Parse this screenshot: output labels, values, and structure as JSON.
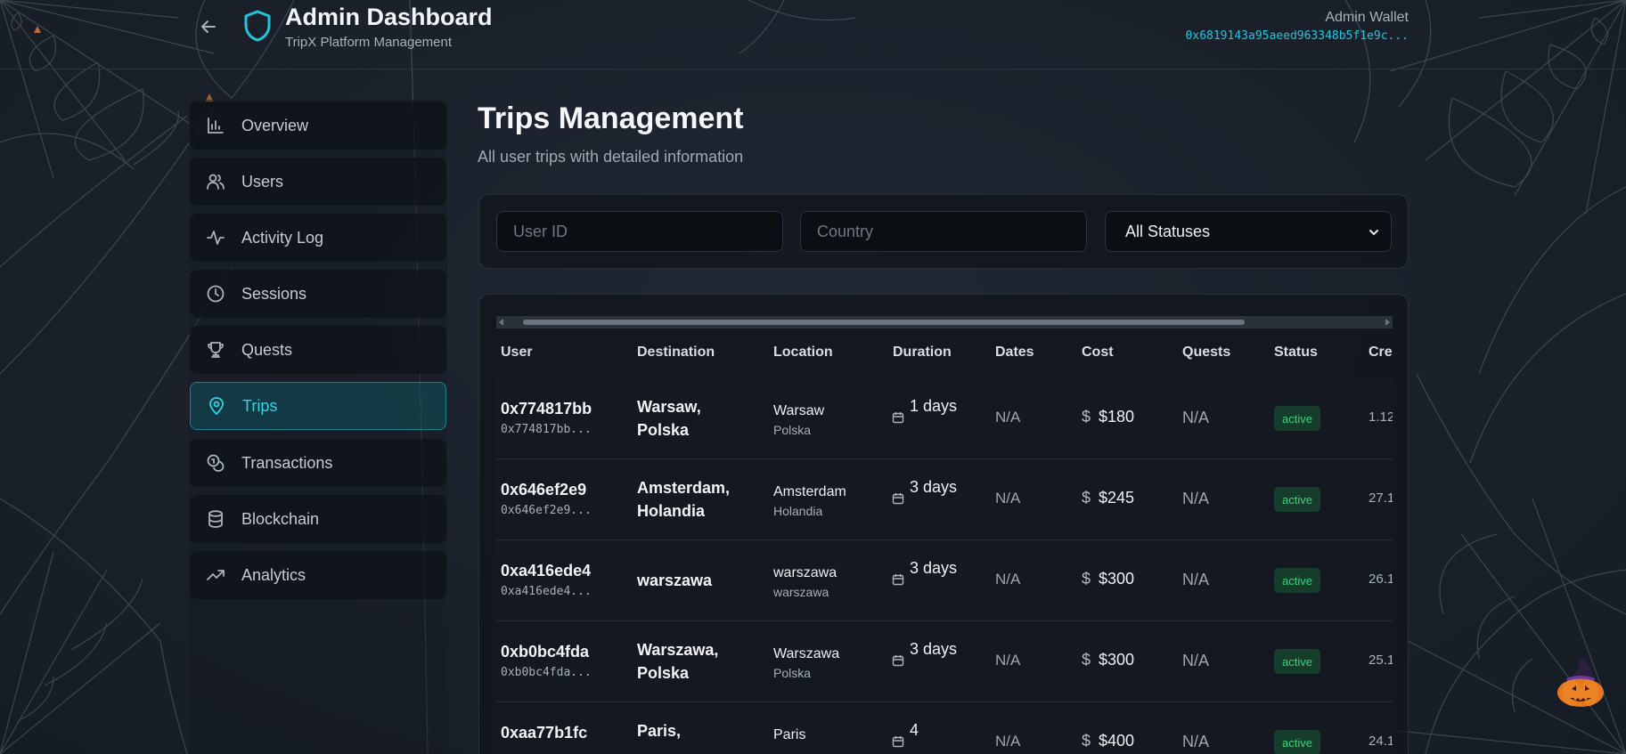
{
  "header": {
    "title": "Admin Dashboard",
    "subtitle": "TripX Platform Management",
    "wallet_label": "Admin Wallet",
    "wallet_address": "0x6819143a95aeed963348b5f1e9c..."
  },
  "sidebar": {
    "items": [
      {
        "label": "Overview",
        "icon": "bar-chart-icon",
        "active": false
      },
      {
        "label": "Users",
        "icon": "users-icon",
        "active": false
      },
      {
        "label": "Activity Log",
        "icon": "activity-icon",
        "active": false
      },
      {
        "label": "Sessions",
        "icon": "clock-icon",
        "active": false
      },
      {
        "label": "Quests",
        "icon": "trophy-icon",
        "active": false
      },
      {
        "label": "Trips",
        "icon": "map-pin-icon",
        "active": true
      },
      {
        "label": "Transactions",
        "icon": "coins-icon",
        "active": false
      },
      {
        "label": "Blockchain",
        "icon": "database-icon",
        "active": false
      },
      {
        "label": "Analytics",
        "icon": "trending-up-icon",
        "active": false
      }
    ]
  },
  "main": {
    "title": "Trips Management",
    "subtitle": "All user trips with detailed information"
  },
  "filters": {
    "user_id_placeholder": "User ID",
    "country_placeholder": "Country",
    "status_selected": "All Statuses"
  },
  "table": {
    "columns": [
      "User",
      "Destination",
      "Location",
      "Duration",
      "Dates",
      "Cost",
      "Quests",
      "Status",
      "Cre"
    ],
    "rows": [
      {
        "user": "0x774817bb",
        "user_short": "0x774817bb...",
        "destination": "Warsaw, Polska",
        "city": "Warsaw",
        "country": "Polska",
        "duration": "1 days",
        "dates": "N/A",
        "cost": "$180",
        "quests": "N/A",
        "status": "active",
        "created": "1.12"
      },
      {
        "user": "0x646ef2e9",
        "user_short": "0x646ef2e9...",
        "destination": "Amsterdam, Holandia",
        "city": "Amsterdam",
        "country": "Holandia",
        "duration": "3 days",
        "dates": "N/A",
        "cost": "$245",
        "quests": "N/A",
        "status": "active",
        "created": "27.1"
      },
      {
        "user": "0xa416ede4",
        "user_short": "0xa416ede4...",
        "destination": "warszawa",
        "city": "warszawa",
        "country": "warszawa",
        "duration": "3 days",
        "dates": "N/A",
        "cost": "$300",
        "quests": "N/A",
        "status": "active",
        "created": "26.1"
      },
      {
        "user": "0xb0bc4fda",
        "user_short": "0xb0bc4fda...",
        "destination": "Warszawa, Polska",
        "city": "Warszawa",
        "country": "Polska",
        "duration": "3 days",
        "dates": "N/A",
        "cost": "$300",
        "quests": "N/A",
        "status": "active",
        "created": "25.1"
      },
      {
        "user": "0xaa77b1fc",
        "user_short": "",
        "destination": "Paris,",
        "city": "Paris",
        "country": "",
        "duration": "4",
        "dates": "N/A",
        "cost": "$400",
        "quests": "N/A",
        "status": "active",
        "created": "24.1"
      }
    ]
  },
  "colors": {
    "accent": "#2fd4ea",
    "background": "#1a212b",
    "status_active_bg": "#163d2c",
    "status_active_text": "#39d27a"
  }
}
